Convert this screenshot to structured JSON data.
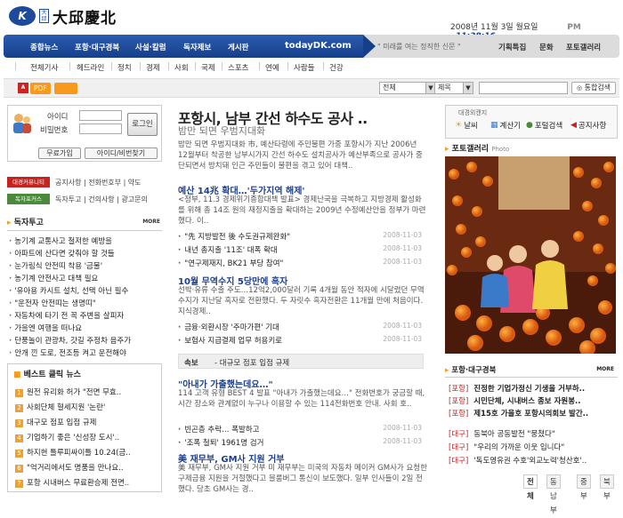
{
  "header": {
    "logo_mark": "K",
    "logo_small": "大邱",
    "logo_text": "大邱慶北",
    "date": "2008년 11월 3일 월요일",
    "time_prefix": "PM",
    "time": "11:38:16"
  },
  "nav": {
    "items": [
      "종합뉴스",
      "포항·대구경북",
      "사설·칼럼",
      "독자제보",
      "게시판"
    ],
    "brand": "todayDK.com",
    "slogan": "\" 미래를 여는 정직한 신문 \"",
    "right_items": [
      "기획특집",
      "문화",
      "포토갤러리"
    ]
  },
  "subnav": {
    "items": [
      "전체기사",
      "헤드라인",
      "정치",
      "경제",
      "사회",
      "국제",
      "스포츠",
      "연예",
      "사람들",
      "건강"
    ]
  },
  "toolbar": {
    "pdf": "PDF",
    "select1": "전체",
    "select2": "제목",
    "search_button": "통합검색"
  },
  "login": {
    "id_label": "아이디",
    "pw_label": "비밀번호",
    "login_button": "로그인",
    "join_button": "무료가입",
    "find_button": "아이디/비번찾기"
  },
  "community": {
    "tag1": "대경커뮤니티",
    "links1": "공지사항 | 전화번호부 | 약도",
    "tag2": "독자포커스",
    "links2": "독자투고 | 건의사항 | 광고문의"
  },
  "reader_section": {
    "title": "독자투고",
    "more": "MORE",
    "items": [
      "농기계 교통사고 철저한 예방을",
      "아파트에 산다면 갖춰야 할 것들",
      "눈가림식 안전띠 착용 '금물'",
      "농기계 안전사고 대책 필요",
      "'유아용 카시트 설치, 선택 아닌 필수",
      "\"운전자 안전띠는 생명띠\"",
      "자동차에 타기 전 꼭 주변을 살피자",
      "가을엔 여행을 떠나요",
      "단풍놀이 관광차, 갓길 주정차 음주가",
      "안개 낀 도로, 전조등 켜고 운전해야"
    ]
  },
  "best": {
    "title": "베스트 클릭 뉴스",
    "title_highlight": "클릭",
    "items": [
      "원전 유리화 허가 \"전면 무효..",
      "사회단체 혈세지원 '논란'",
      "대구모 점포 입점 규제",
      "기업하기 좋은 '신성장 도시'..",
      "하지현 틀루피싸이틀 10.24(금..",
      "\"억거리에서도 명품을 만나요..",
      "포항 시내버스 무료환승제 전면.."
    ]
  },
  "center": {
    "headline": "포항시, 남부 간선 하수도 공사 ..",
    "subhead": "밤만 되면 우범지대화",
    "lead": "밤만 되면 우범지대화 市, 예산타령에 주민불편 가중 포항시가 지난 2006년 12월부터 착공한 남부시가지 간선 하수도 설치공사가 예산부족으로 공사가 중단되면서 방치돼 인근 주민들이 불편을 겪고 있어 대책..",
    "story2_title": "예산 14兆 확대…'두가지역 해제'",
    "story2_body": "<정부, 11.3 경제위기종합대책 발표> 경제난국을 극복하고 지방경제 활성화를 위해 총 14조 원의 재정지출을 확대하는 2009년 수정예산안을 정부가 마련했다. 이..",
    "list1": [
      {
        "text": "\"先 지방발전 後 수도권규제완화\"",
        "date": "2008-11-03"
      },
      {
        "text": "내년 총지출 '11조' 대폭 확대",
        "date": "2008-11-03"
      },
      {
        "text": "\"연구제재지, BK21 부당 참여\"",
        "date": "2008-11-03"
      }
    ],
    "story3_title": "10월 무역수지 5당만에 흑자",
    "story3_body": "선박·유류 수출 주도…12억2,000달러 기록 4개월 동안 적자에 시달렸던 무역수지가 지난달 흑자로 전환했다. 두 자릿수 흑자전환은 11개월 만에 처음이다. 지식경제..",
    "list2": [
      {
        "text": "금융·외환시장 '주마가편' 기대",
        "date": "2008-11-03"
      },
      {
        "text": "보험사 지급결제 업무 허용키로",
        "date": "2008-11-03"
      }
    ],
    "breaking_tag": "속보",
    "breaking_text": "- 대규모 점포 입점 규제",
    "story4_title": "\"아내가 가출했는데요…\"",
    "story4_body": "114 고객 유형 BEST 4 발표 \"아내가 가출했는데요…\" 전화번호가 궁금할 때, 시간 장소와 관계없이 누구나 이용할 수 있는 114전화번호 안내. 사회 호..",
    "list3": [
      {
        "text": "빈곤층 추락… 폭발하고",
        "date": "2008-11-03"
      },
      {
        "text": "'조폭 철퇴' 1961명 검거",
        "date": "2008-11-03"
      }
    ],
    "story5_title": "美 재무부, GM사 지원 거부",
    "story5_body": "美 재무부, GM사 지원 거부 미 재무부는 미국의 자동차 메이커 GM사가 요청한 구제금융 지원을 거절했다고 블룸버그 통신이 보도했다. 일부 인사들이 2일 전했다. 당초 GM사는 경.."
  },
  "right": {
    "menu_caption": "대경외캔지",
    "menu_items": [
      {
        "icon": "sun-icon",
        "label": "날씨"
      },
      {
        "icon": "calculator-icon",
        "label": "계산기"
      },
      {
        "icon": "search-icon",
        "label": "포털검색"
      },
      {
        "icon": "speaker-icon",
        "label": "공지사항"
      }
    ],
    "photo_title": "포토갤러리",
    "photo_sub": "Photo",
    "section2_title": "포항·대구경북",
    "section2_more": "MORE",
    "news": [
      {
        "cat": "[포항]",
        "text": "진정한 기업가정신 기생을 거부하..",
        "bold": true
      },
      {
        "cat": "[포항]",
        "text": "시민단체, 시내버스 종보 자원봉..",
        "bold": true
      },
      {
        "cat": "[포항]",
        "text": "제15호 가을호 포항시의회보 발간..",
        "bold": true
      },
      {
        "cat": "[대구]",
        "text": "동북아 공동발전 \"뭉쳤다\"",
        "bold": false
      },
      {
        "cat": "[대구]",
        "text": "\"우리의 가까운 이웃 입니다\"",
        "bold": false
      },
      {
        "cat": "[대구]",
        "text": "'독도영유권 수호'외교노력'청산호'..",
        "bold": false
      }
    ],
    "tabs": [
      "전체",
      "동남부",
      "중부",
      "북부"
    ]
  },
  "colors": {
    "nav_blue": "#163f8a",
    "headline_blue": "#1d3f8c",
    "category_red": "#c02020",
    "accent_orange": "#f79a1e"
  }
}
